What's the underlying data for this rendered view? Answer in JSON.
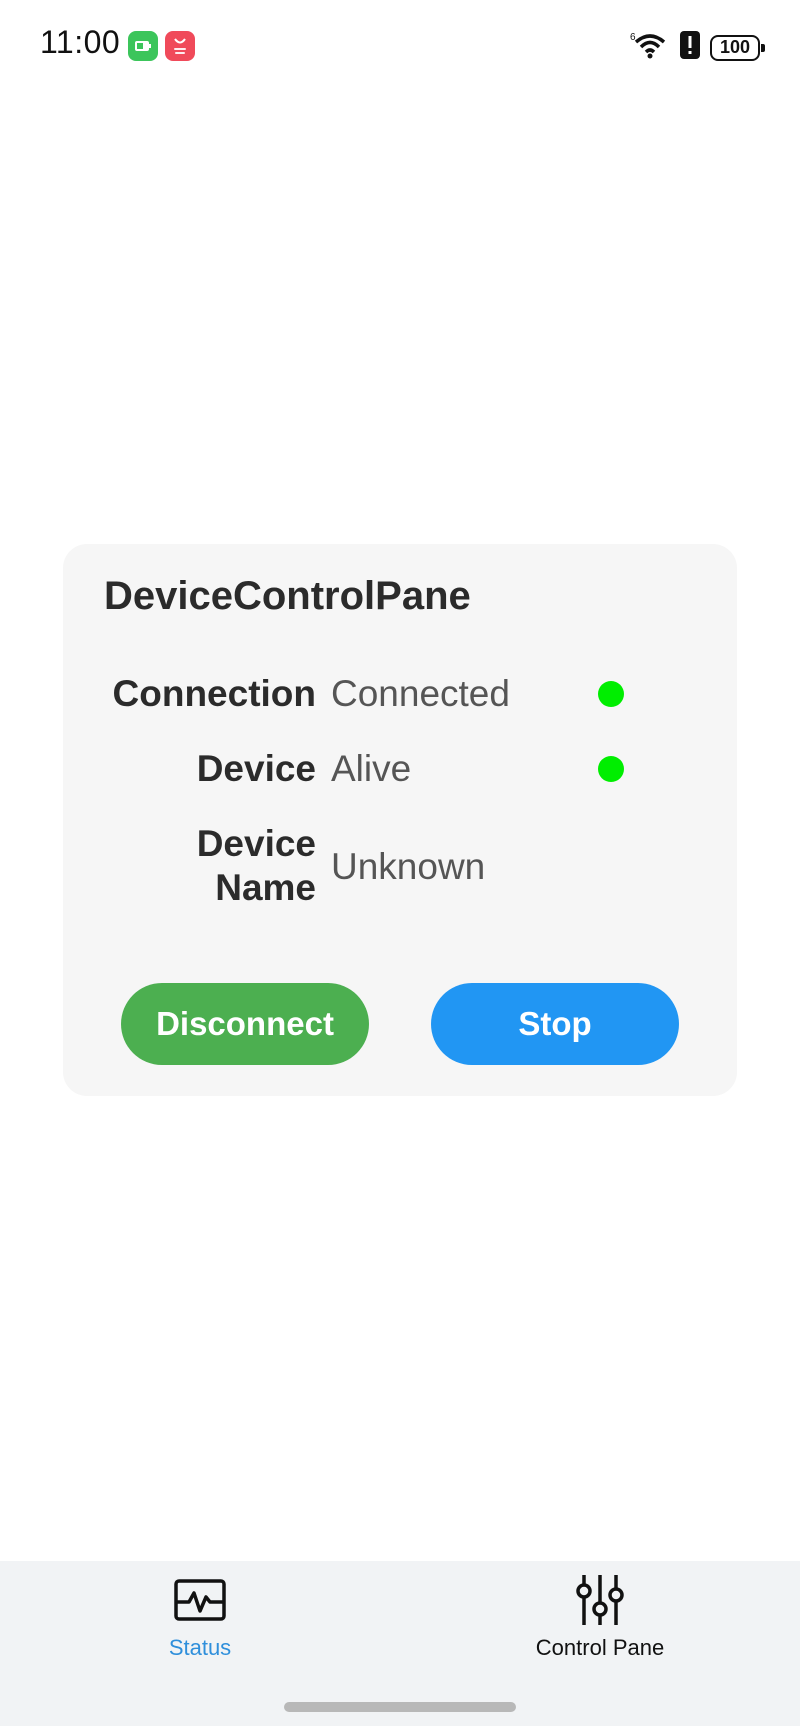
{
  "status_bar": {
    "time": "11:00",
    "app_icons": [
      "battery-saver-app-icon",
      "app-gallery-icon"
    ],
    "battery_level": "100"
  },
  "card": {
    "title": "DeviceControlPane",
    "rows": [
      {
        "label": "Connection",
        "value": "Connected",
        "indicator_color": "#00ee00"
      },
      {
        "label": "Device",
        "value": "Alive",
        "indicator_color": "#00ee00"
      },
      {
        "label_line1": "Device",
        "label_line2": "Name",
        "value": "Unknown"
      }
    ],
    "buttons": {
      "disconnect": "Disconnect",
      "stop": "Stop"
    }
  },
  "bottom_nav": {
    "tabs": [
      {
        "label": "Status",
        "icon": "pulse-monitor-icon",
        "active": true
      },
      {
        "label": "Control Pane",
        "icon": "sliders-icon",
        "active": false
      }
    ]
  },
  "colors": {
    "active_tab": "#2f8fdb",
    "disconnect_button": "#4caf50",
    "stop_button": "#2196f3",
    "status_ok": "#00ee00"
  }
}
